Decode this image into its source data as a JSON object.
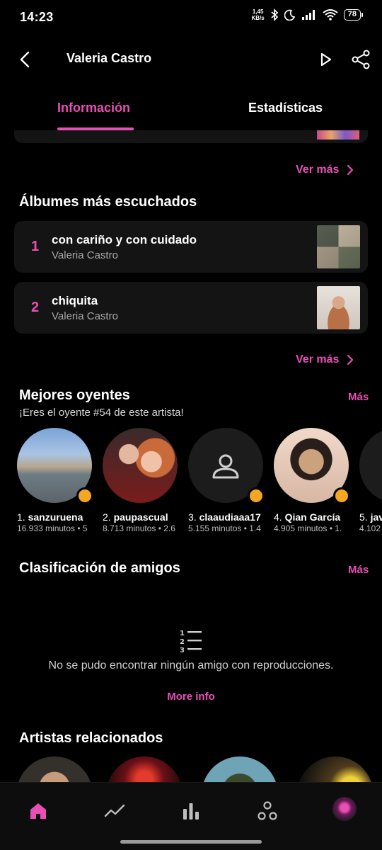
{
  "status_bar": {
    "time": "14:23",
    "speed_top": "1,45",
    "speed_bottom": "KB/s",
    "battery": "78"
  },
  "header": {
    "title": "Valeria Castro"
  },
  "tabs": [
    {
      "label": "Información",
      "active": true
    },
    {
      "label": "Estadísticas",
      "active": false
    }
  ],
  "top_tracks": {
    "more_label": "Ver más"
  },
  "albums": {
    "title": "Álbumes más escuchados",
    "items": [
      {
        "rank": "1",
        "name": "con cariño y con cuidado",
        "artist": "Valeria Castro"
      },
      {
        "rank": "2",
        "name": "chiquita",
        "artist": "Valeria Castro"
      }
    ],
    "more_label": "Ver más"
  },
  "top_listeners": {
    "title": "Mejores oyentes",
    "subtitle": "¡Eres el oyente #54 de este artista!",
    "more_label": "Más",
    "items": [
      {
        "rank": "1.",
        "name": "sanzuruena",
        "minutes": "16.933 minutos • 5"
      },
      {
        "rank": "2.",
        "name": "paupascual",
        "minutes": "8.713 minutos • 2.6"
      },
      {
        "rank": "3.",
        "name": "claaudiaaa17",
        "minutes": "5.155 minutos • 1.4"
      },
      {
        "rank": "4.",
        "name": "Qian García",
        "minutes": "4.905 minutos • 1."
      },
      {
        "rank": "5.",
        "name": "jav",
        "minutes": "4.102"
      }
    ]
  },
  "friends_ranking": {
    "title": "Clasificación de amigos",
    "more_label": "Más",
    "empty_text": "No se pudo encontrar ningún amigo con reproducciones.",
    "more_info": "More info"
  },
  "related_artists": {
    "title": "Artistas relacionados"
  },
  "colors": {
    "accent": "#e84fb6",
    "badge": "#f5a623",
    "card": "#141414",
    "background": "#000000"
  },
  "icons": {
    "back": "back-arrow-icon",
    "play": "play-icon",
    "share": "share-icon",
    "nav": [
      "home-icon",
      "trend-icon",
      "bar-chart-icon",
      "friends-icon",
      "profile-avatar"
    ]
  }
}
